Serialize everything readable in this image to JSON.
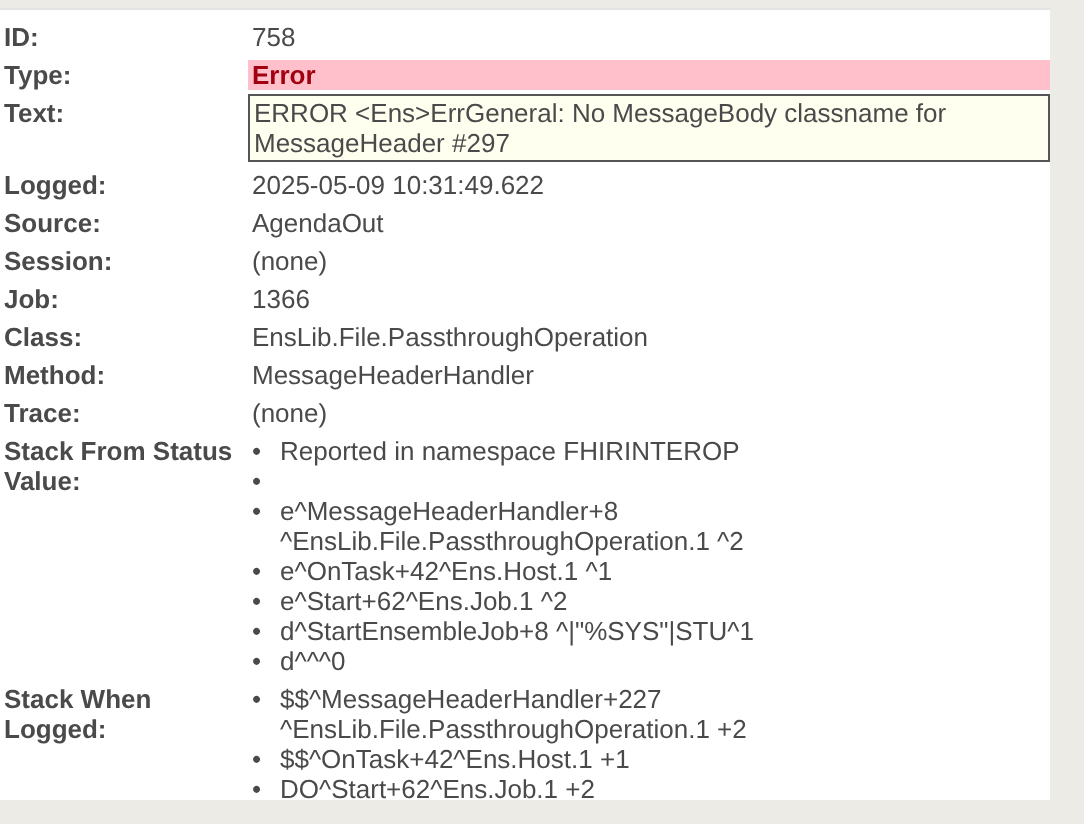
{
  "fields": [
    {
      "label": "ID:",
      "kind": "plain",
      "value": "758"
    },
    {
      "label": "Type:",
      "kind": "error",
      "value": "Error"
    },
    {
      "label": "Text:",
      "kind": "textbox",
      "value": "ERROR <Ens>ErrGeneral: No MessageBody classname for MessageHeader #297"
    },
    {
      "label": "Logged:",
      "kind": "plain",
      "value": "2025-05-09 10:31:49.622"
    },
    {
      "label": "Source:",
      "kind": "plain",
      "value": "AgendaOut"
    },
    {
      "label": "Session:",
      "kind": "plain",
      "value": "(none)"
    },
    {
      "label": "Job:",
      "kind": "plain",
      "value": "1366"
    },
    {
      "label": "Class:",
      "kind": "plain",
      "value": "EnsLib.File.PassthroughOperation"
    },
    {
      "label": "Method:",
      "kind": "plain",
      "value": "MessageHeaderHandler"
    },
    {
      "label": "Trace:",
      "kind": "plain",
      "value": "(none)"
    },
    {
      "label": "Stack From Status Value:",
      "kind": "list",
      "items": [
        {
          "marker": "•",
          "text": "Reported in namespace FHIRINTEROP"
        },
        {
          "marker": "•"
        },
        {
          "marker": "•",
          "text": "e^MessageHeaderHandler+8\n^EnsLib.File.PassthroughOperation.1 ^2"
        },
        {
          "marker": "•",
          "text": "e^OnTask+42^Ens.Host.1 ^1"
        },
        {
          "marker": "•",
          "text": "e^Start+62^Ens.Job.1 ^2"
        },
        {
          "marker": "•",
          "text": "d^StartEnsembleJob+8 ^|\"%SYS\"|STU^1"
        },
        {
          "marker": "•",
          "text": "d^^^0"
        }
      ]
    },
    {
      "label": "Stack When Logged:",
      "kind": "list",
      "items": [
        {
          "marker": "•",
          "text": "$$^MessageHeaderHandler+227\n^EnsLib.File.PassthroughOperation.1 +2"
        },
        {
          "marker": "•",
          "text": "$$^OnTask+42^Ens.Host.1 +1"
        },
        {
          "marker": "•",
          "text": "DO^Start+62^Ens.Job.1 +2"
        }
      ]
    }
  ]
}
